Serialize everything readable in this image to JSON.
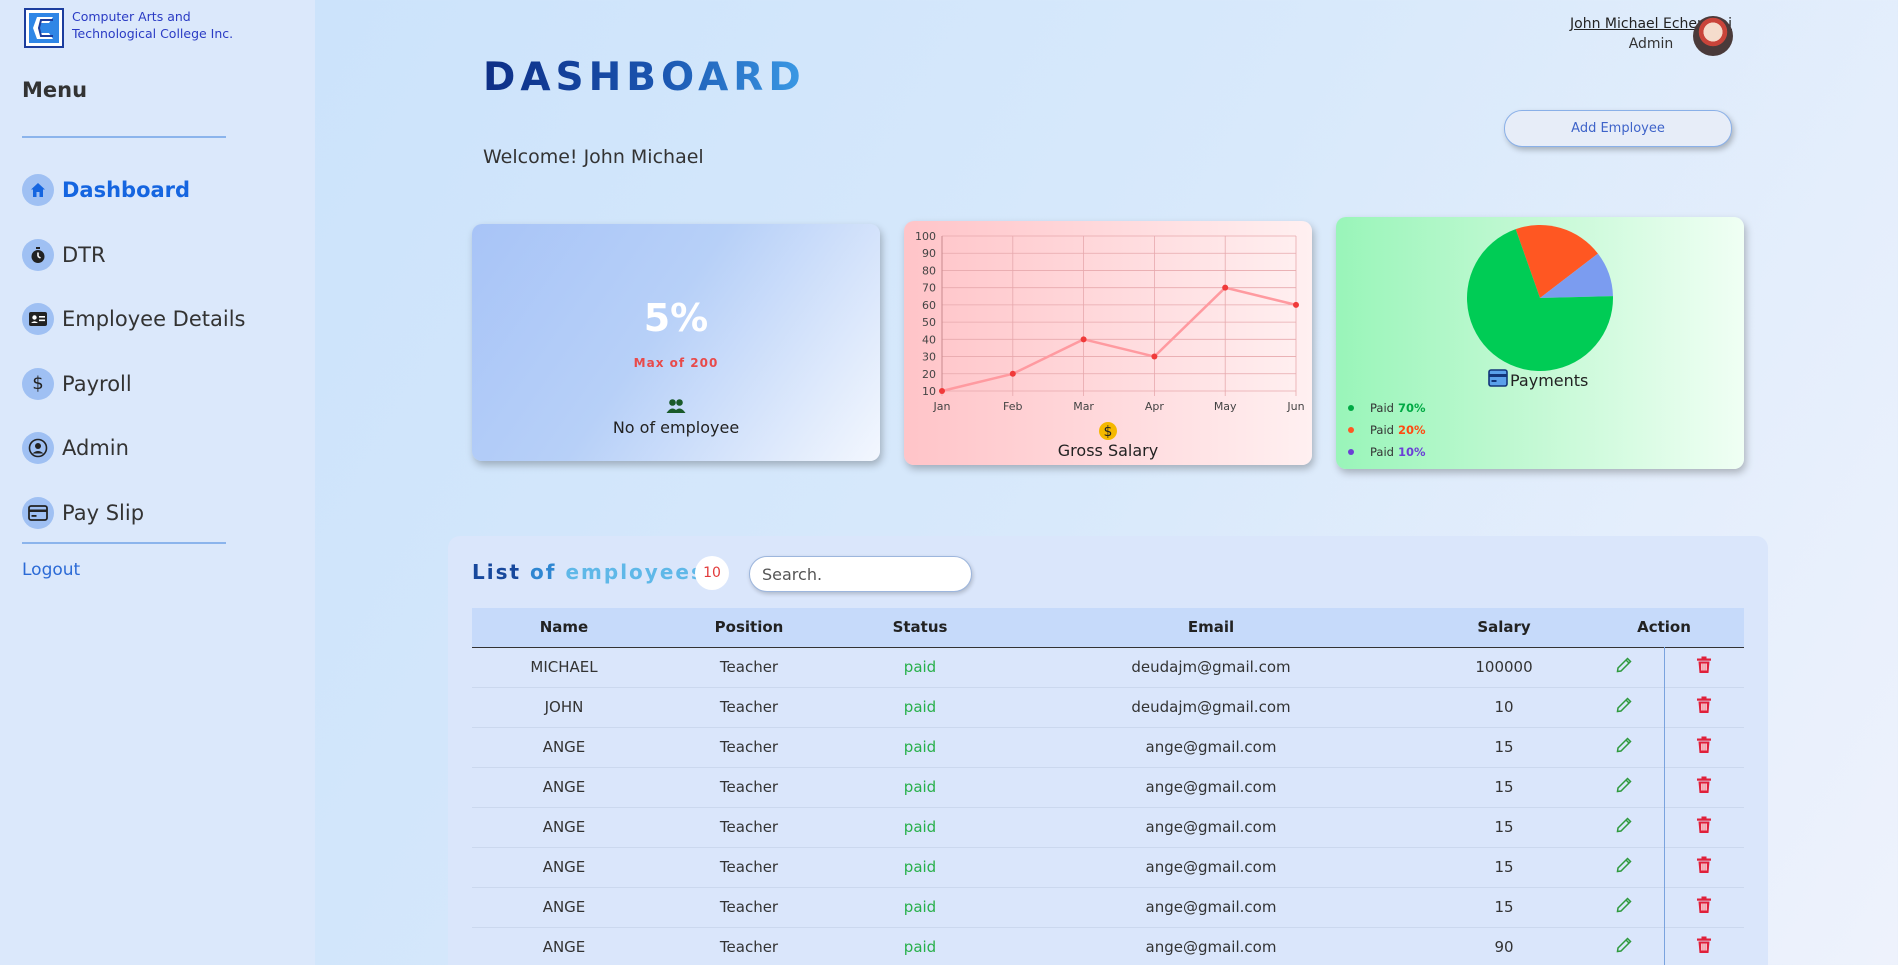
{
  "brand": {
    "line1": "Computer Arts and",
    "line2": "Technological College Inc."
  },
  "sidebar": {
    "menu_title": "Menu",
    "items": [
      {
        "label": "Dashboard",
        "icon": "home-icon"
      },
      {
        "label": "DTR",
        "icon": "stopwatch-icon"
      },
      {
        "label": "Employee Details",
        "icon": "id-card-icon"
      },
      {
        "label": "Payroll",
        "icon": "dollar-icon"
      },
      {
        "label": "Admin",
        "icon": "user-circle-icon"
      },
      {
        "label": "Pay Slip",
        "icon": "credit-card-icon"
      }
    ],
    "active_index": 0,
    "logout": "Logout"
  },
  "header": {
    "title": "DASHBOARD",
    "welcome": "Welcome! John Michael",
    "user_name": "John Michael Echemani",
    "user_role": "Admin",
    "add_button": "Add Employee"
  },
  "cards": {
    "employees": {
      "percent": "5%",
      "max_text": "Max of 200",
      "label": "No of employee"
    },
    "salary": {
      "label": "Gross Salary"
    },
    "payments": {
      "label": "Payments",
      "legend": [
        {
          "prefix": "Paid",
          "value": "70%",
          "color": "#00cc55"
        },
        {
          "prefix": "Paid",
          "value": "20%",
          "color": "#ff5722"
        },
        {
          "prefix": "Paid",
          "value": "10%",
          "color": "#6b3fd6"
        }
      ]
    }
  },
  "chart_data": [
    {
      "type": "line",
      "categories": [
        "Jan",
        "Feb",
        "Mar",
        "Apr",
        "May",
        "Jun"
      ],
      "series": [
        {
          "values": [
            10,
            20,
            40,
            30,
            70,
            60
          ],
          "color": "#ff9aa0"
        }
      ],
      "ylim": [
        10,
        100
      ],
      "yticks": [
        10,
        20,
        30,
        40,
        50,
        60,
        70,
        80,
        90,
        100
      ],
      "grid": true,
      "xlabel": "",
      "ylabel": ""
    },
    {
      "type": "pie",
      "slices": [
        {
          "value": 70,
          "color": "#00cc55"
        },
        {
          "value": 20,
          "color": "#ff5722"
        },
        {
          "value": 10,
          "color": "#7b9cf0"
        }
      ]
    }
  ],
  "list": {
    "title_part1": "List",
    "title_part2": "of",
    "title_part3": "employees",
    "count": "10",
    "search_placeholder": "Search.",
    "columns": [
      "Name",
      "Position",
      "Status",
      "Email",
      "Salary",
      "Action"
    ],
    "rows": [
      {
        "name": "MICHAEL",
        "position": "Teacher",
        "status": "paid",
        "email": "deudajm@gmail.com",
        "salary": "100000"
      },
      {
        "name": "JOHN",
        "position": "Teacher",
        "status": "paid",
        "email": "deudajm@gmail.com",
        "salary": "10"
      },
      {
        "name": "ANGE",
        "position": "Teacher",
        "status": "paid",
        "email": "ange@gmail.com",
        "salary": "15"
      },
      {
        "name": "ANGE",
        "position": "Teacher",
        "status": "paid",
        "email": "ange@gmail.com",
        "salary": "15"
      },
      {
        "name": "ANGE",
        "position": "Teacher",
        "status": "paid",
        "email": "ange@gmail.com",
        "salary": "15"
      },
      {
        "name": "ANGE",
        "position": "Teacher",
        "status": "paid",
        "email": "ange@gmail.com",
        "salary": "15"
      },
      {
        "name": "ANGE",
        "position": "Teacher",
        "status": "paid",
        "email": "ange@gmail.com",
        "salary": "15"
      },
      {
        "name": "ANGE",
        "position": "Teacher",
        "status": "paid",
        "email": "ange@gmail.com",
        "salary": "90"
      }
    ]
  }
}
